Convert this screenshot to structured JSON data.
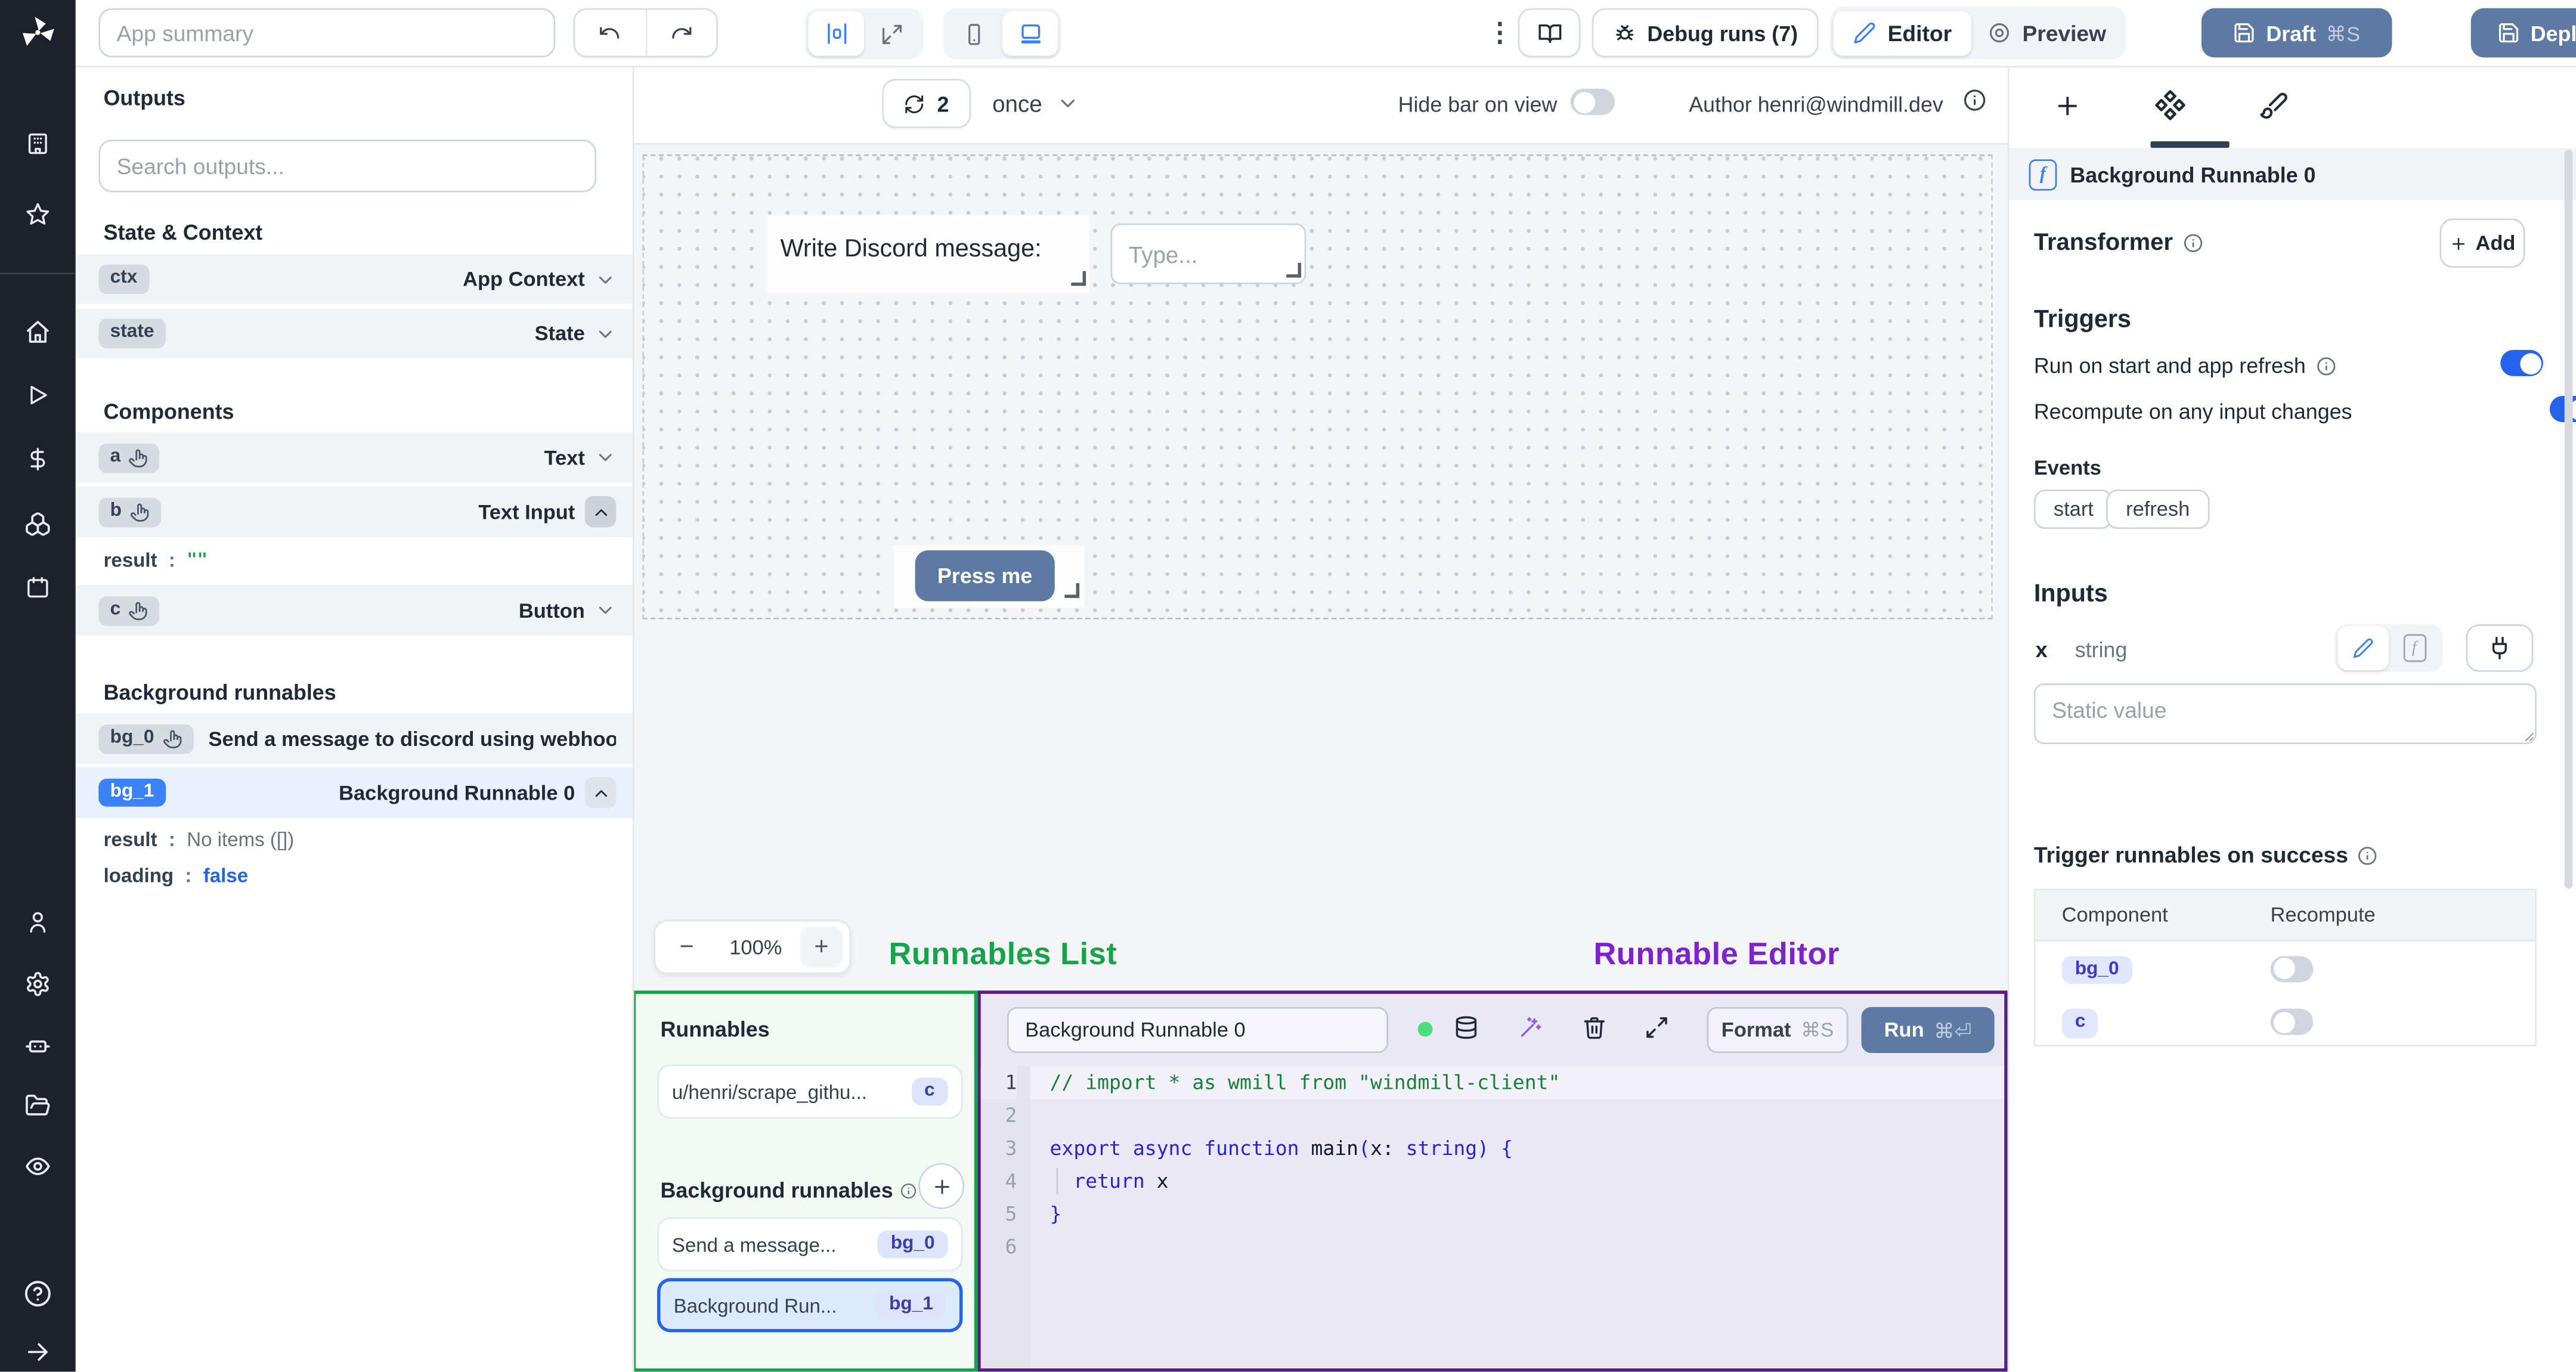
{
  "colors": {
    "accent_blue": "#2563eb",
    "slate_button": "#5d7aa4",
    "green": "#16a34a",
    "purple": "#7e22ce",
    "badge_blue": "#3b82f6"
  },
  "sidebar": {
    "icons": [
      "building-icon",
      "star-icon",
      "home-icon",
      "play-icon",
      "dollar-icon",
      "boxes-icon",
      "calendar-icon",
      "user-icon",
      "settings-icon",
      "worker-icon",
      "folder-icon",
      "eye-icon",
      "help-icon",
      "expand-arrow-icon"
    ]
  },
  "topbar": {
    "app_summary_placeholder": "App summary",
    "kebab": "⋮",
    "debug_runs": "Debug runs (7)",
    "editor": "Editor",
    "preview": "Preview",
    "draft": "Draft",
    "draft_shortcut": "⌘S",
    "deploy": "Deploy"
  },
  "outputs": {
    "title": "Outputs",
    "search_placeholder": "Search outputs...",
    "state_context": {
      "title": "State & Context",
      "rows": [
        {
          "id": "ctx",
          "type": "App Context"
        },
        {
          "id": "state",
          "type": "State"
        }
      ]
    },
    "components": {
      "title": "Components",
      "rows": [
        {
          "id": "a",
          "type": "Text"
        },
        {
          "id": "b",
          "type": "Text Input"
        },
        {
          "id": "c",
          "type": "Button"
        }
      ],
      "b_detail": {
        "key": "result",
        "value": "\"\""
      }
    },
    "background": {
      "title": "Background runnables",
      "rows": [
        {
          "id": "bg_0",
          "type": "Send a message to discord using webhoo"
        },
        {
          "id": "bg_1",
          "type": "Background Runnable 0"
        }
      ],
      "bg1_details": [
        {
          "key": "result",
          "value": "No items ([])"
        },
        {
          "key": "loading",
          "value": "false"
        }
      ]
    }
  },
  "canvas_toolbar": {
    "refresh_count": "2",
    "frequency": "once",
    "hide_bar_label": "Hide bar on view",
    "author": "Author henri@windmill.dev"
  },
  "canvas": {
    "text_component": "Write Discord message:",
    "input_placeholder": "Type...",
    "button_label": "Press me",
    "zoom_out": "−",
    "zoom_level": "100%",
    "zoom_in": "+"
  },
  "annotations": {
    "runnables_list": "Runnables List",
    "runnable_editor": "Runnable Editor"
  },
  "runnables_panel": {
    "title": "Runnables",
    "script_item": {
      "label": "u/henri/scrape_githu...",
      "badge": "c"
    },
    "group_title": "Background runnables",
    "items": [
      {
        "label": "Send a message...",
        "badge": "bg_0"
      },
      {
        "label": "Background Run...",
        "badge": "bg_1"
      }
    ]
  },
  "editor": {
    "name": "Background Runnable 0",
    "format": "Format",
    "format_shortcut": "⌘S",
    "run": "Run",
    "run_shortcut": "⌘⏎",
    "nums": {
      "n1": "1",
      "n2": "2",
      "n3": "3",
      "n4": "4",
      "n5": "5",
      "n6": "6"
    },
    "code": {
      "l1": "// import * as wmill from \"windmill-client\"",
      "l3_kw1": "export async function ",
      "l3_id": "main",
      "l3_p1": "(",
      "l3_a1": "x: ",
      "l3_kw2": "string",
      "l3_p2": ") {",
      "l4_kw": "  return ",
      "l4_id": "x",
      "l5": "}"
    }
  },
  "inspector": {
    "header": "Background Runnable 0",
    "transformer": {
      "label": "Transformer",
      "add": "Add"
    },
    "triggers": {
      "title": "Triggers",
      "row1": "Run on start and app refresh",
      "row2": "Recompute on any input changes",
      "events_label": "Events",
      "events": [
        {
          "label": "start"
        },
        {
          "label": "refresh"
        }
      ]
    },
    "inputs": {
      "title": "Inputs",
      "field": "x",
      "type": "string",
      "placeholder": "Static value"
    },
    "on_success": {
      "title": "Trigger runnables on success",
      "col1": "Component",
      "col2": "Recompute",
      "rows": [
        {
          "badge": "bg_0"
        },
        {
          "badge": "c"
        }
      ]
    }
  }
}
